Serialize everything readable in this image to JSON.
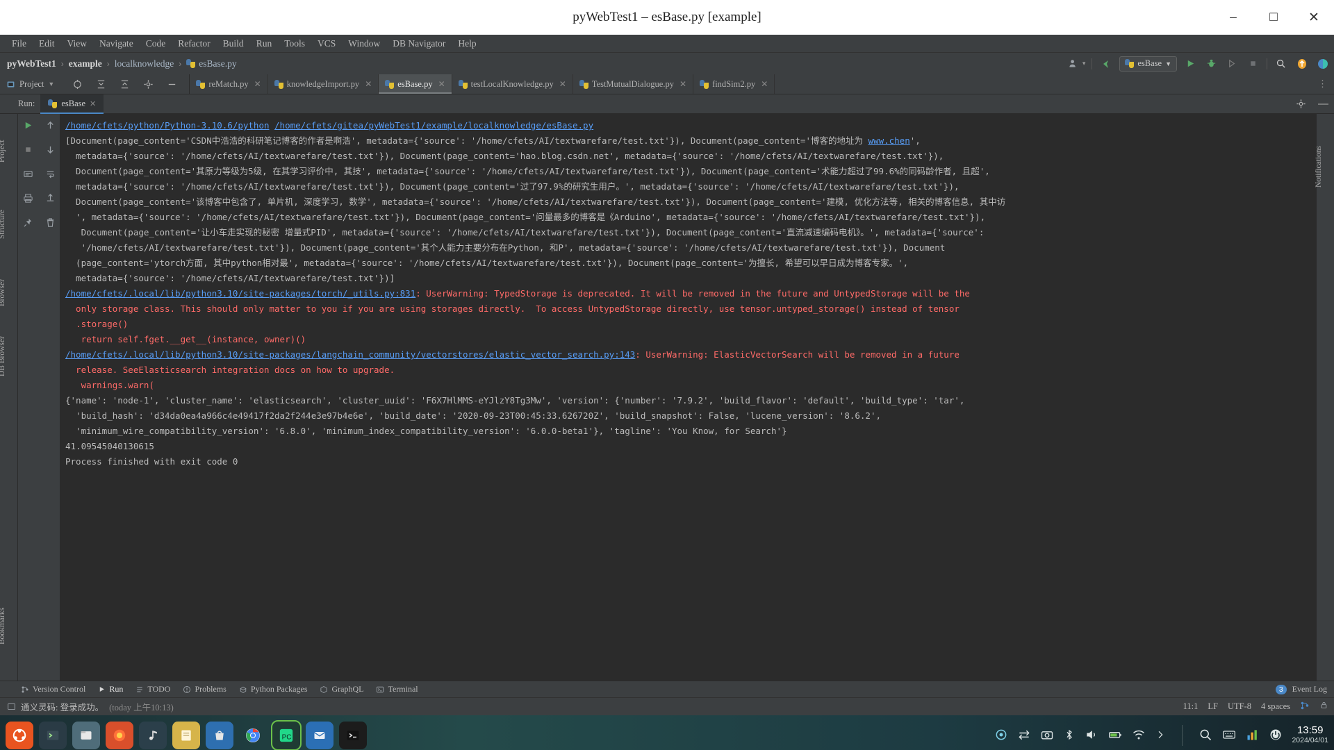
{
  "window": {
    "title": "pyWebTest1 – esBase.py [example]",
    "minimize": "–",
    "maximize": "□",
    "close": "✕"
  },
  "menubar": {
    "items": [
      "File",
      "Edit",
      "View",
      "Navigate",
      "Code",
      "Refactor",
      "Build",
      "Run",
      "Tools",
      "VCS",
      "Window",
      "DB Navigator",
      "Help"
    ]
  },
  "navbar": {
    "crumbs": [
      "pyWebTest1",
      "example",
      "localknowledge",
      "esBase.py"
    ],
    "separator": "›",
    "run_config": "esBase",
    "run_config_caret": "▼",
    "icons": {
      "account": "account-icon",
      "account_caret": "▾",
      "vcs_update": "vcs-update-icon",
      "run": "▶",
      "debug": "debug-icon",
      "coverage": "coverage-icon",
      "stop": "■",
      "search": "search-icon",
      "updates": "updates-icon",
      "tips": "tips-icon"
    }
  },
  "tabbar": {
    "project_button": "Project",
    "project_caret": "▼",
    "toolbar_icons": [
      "target-icon",
      "collapse-all-icon",
      "expand-all-icon",
      "settings-gear-icon",
      "hide-icon"
    ],
    "more_icon": "⋮",
    "files": [
      {
        "name": "reMatch.py",
        "active": false,
        "close": "✕"
      },
      {
        "name": "knowledgeImport.py",
        "active": false,
        "close": "✕"
      },
      {
        "name": "esBase.py",
        "active": true,
        "close": "✕"
      },
      {
        "name": "testLocalKnowledge.py",
        "active": false,
        "close": "✕"
      },
      {
        "name": "TestMutualDialogue.py",
        "active": false,
        "close": "✕"
      },
      {
        "name": "findSim2.py",
        "active": false,
        "close": "✕"
      }
    ]
  },
  "run_window": {
    "label": "Run:",
    "tab": "esBase",
    "tab_close": "✕",
    "settings_icon": "settings-gear-icon",
    "minimize_icon": "—",
    "gutter_icons": [
      "rerun-run-icon",
      "scroll-up-icon",
      "scroll-down-icon",
      "stop-icon",
      "wrap-icon",
      "print-icon",
      "soft-wrap-icon",
      "pin-icon",
      "export-icon",
      "trash-icon"
    ]
  },
  "console": {
    "lines": [
      {
        "type": "cmd",
        "segments": [
          {
            "t": "link",
            "v": "/home/cfets/python/Python-3.10.6/python"
          },
          {
            "t": "plain",
            "v": " "
          },
          {
            "t": "link",
            "v": "/home/cfets/gitea/pyWebTest1/example/localknowledge/esBase.py"
          }
        ]
      },
      {
        "type": "out",
        "segments": [
          {
            "t": "plain",
            "v": "[Document(page_content='CSDN中浩浩的科研笔记博客的作者是啊浩', metadata={'source': '/home/cfets/AI/textwarefare/test.txt'}), Document(page_content='博客的地址为 "
          },
          {
            "t": "link",
            "v": "www.chen"
          },
          {
            "t": "plain",
            "v": "',"
          }
        ]
      },
      {
        "type": "out",
        "segments": [
          {
            "t": "plain",
            "v": "  metadata={'source': '/home/cfets/AI/textwarefare/test.txt'}), Document(page_content='hao.blog.csdn.net', metadata={'source': '/home/cfets/AI/textwarefare/test.txt'}),"
          }
        ]
      },
      {
        "type": "out",
        "segments": [
          {
            "t": "plain",
            "v": "  Document(page_content='其原力等级为5级, 在其学习评价中, 其技', metadata={'source': '/home/cfets/AI/textwarefare/test.txt'}), Document(page_content='术能力超过了99.6%的同码龄作者, 且超',"
          }
        ]
      },
      {
        "type": "out",
        "segments": [
          {
            "t": "plain",
            "v": "  metadata={'source': '/home/cfets/AI/textwarefare/test.txt'}), Document(page_content='过了97.9%的研究生用户。', metadata={'source': '/home/cfets/AI/textwarefare/test.txt'}),"
          }
        ]
      },
      {
        "type": "out",
        "segments": [
          {
            "t": "plain",
            "v": "  Document(page_content='该博客中包含了, 单片机, 深度学习, 数学', metadata={'source': '/home/cfets/AI/textwarefare/test.txt'}), Document(page_content='建模, 优化方法等, 相关的博客信息, 其中访"
          }
        ]
      },
      {
        "type": "out",
        "segments": [
          {
            "t": "plain",
            "v": "  ', metadata={'source': '/home/cfets/AI/textwarefare/test.txt'}), Document(page_content='问量最多的博客是《Arduino', metadata={'source': '/home/cfets/AI/textwarefare/test.txt'}),"
          }
        ]
      },
      {
        "type": "out",
        "segments": [
          {
            "t": "plain",
            "v": "   Document(page_content='让小车走实现的秘密 增量式PID', metadata={'source': '/home/cfets/AI/textwarefare/test.txt'}), Document(page_content='直流减速编码电机》。', metadata={'source':"
          }
        ]
      },
      {
        "type": "out",
        "segments": [
          {
            "t": "plain",
            "v": "   '/home/cfets/AI/textwarefare/test.txt'}), Document(page_content='其个人能力主要分布在Python, 和P', metadata={'source': '/home/cfets/AI/textwarefare/test.txt'}), Document"
          }
        ]
      },
      {
        "type": "out",
        "segments": [
          {
            "t": "plain",
            "v": "  (page_content='ytorch方面, 其中python相对最', metadata={'source': '/home/cfets/AI/textwarefare/test.txt'}), Document(page_content='为擅长, 希望可以早日成为博客专家。',"
          }
        ]
      },
      {
        "type": "out",
        "segments": [
          {
            "t": "plain",
            "v": "  metadata={'source': '/home/cfets/AI/textwarefare/test.txt'})]"
          }
        ]
      },
      {
        "type": "warn",
        "segments": [
          {
            "t": "link",
            "v": "/home/cfets/.local/lib/python3.10/site-packages/torch/_utils.py:831"
          },
          {
            "t": "warn",
            "v": ": UserWarning: TypedStorage is deprecated. It will be removed in the future and UntypedStorage will be the"
          }
        ]
      },
      {
        "type": "warn",
        "segments": [
          {
            "t": "warn",
            "v": "  only storage class. This should only matter to you if you are using storages directly.  To access UntypedStorage directly, use tensor.untyped_storage() instead of tensor"
          }
        ]
      },
      {
        "type": "warn",
        "segments": [
          {
            "t": "warn",
            "v": "  .storage()"
          }
        ]
      },
      {
        "type": "warn",
        "segments": [
          {
            "t": "warn",
            "v": "   return self.fget.__get__(instance, owner)()"
          }
        ]
      },
      {
        "type": "warn",
        "segments": [
          {
            "t": "link",
            "v": "/home/cfets/.local/lib/python3.10/site-packages/langchain_community/vectorstores/elastic_vector_search.py:143"
          },
          {
            "t": "warn",
            "v": ": UserWarning: ElasticVectorSearch will be removed in a future"
          }
        ]
      },
      {
        "type": "warn",
        "segments": [
          {
            "t": "warn",
            "v": "  release. SeeElasticsearch integration docs on how to upgrade."
          }
        ]
      },
      {
        "type": "warn",
        "segments": [
          {
            "t": "warn",
            "v": "   warnings.warn("
          }
        ]
      },
      {
        "type": "out",
        "segments": [
          {
            "t": "plain",
            "v": "{'name': 'node-1', 'cluster_name': 'elasticsearch', 'cluster_uuid': 'F6X7HlMMS-eYJlzY8Tg3Mw', 'version': {'number': '7.9.2', 'build_flavor': 'default', 'build_type': 'tar',"
          }
        ]
      },
      {
        "type": "out",
        "segments": [
          {
            "t": "plain",
            "v": "  'build_hash': 'd34da0ea4a966c4e49417f2da2f244e3e97b4e6e', 'build_date': '2020-09-23T00:45:33.626720Z', 'build_snapshot': False, 'lucene_version': '8.6.2',"
          }
        ]
      },
      {
        "type": "out",
        "segments": [
          {
            "t": "plain",
            "v": "  'minimum_wire_compatibility_version': '6.8.0', 'minimum_index_compatibility_version': '6.0.0-beta1'}, 'tagline': 'You Know, for Search'}"
          }
        ]
      },
      {
        "type": "out",
        "segments": [
          {
            "t": "plain",
            "v": "41.09545040130615"
          }
        ]
      },
      {
        "type": "out",
        "segments": [
          {
            "t": "plain",
            "v": ""
          }
        ]
      },
      {
        "type": "out",
        "segments": [
          {
            "t": "plain",
            "v": "Process finished with exit code 0"
          }
        ]
      }
    ]
  },
  "left_strips": [
    "Project",
    "Structure",
    "Browser",
    "DB Browser",
    "Bookmarks"
  ],
  "right_strips": [
    "Notifications"
  ],
  "toolstrip": {
    "items": [
      {
        "label": "Version Control",
        "icon": "branch-icon"
      },
      {
        "label": "Run",
        "icon": "run-icon"
      },
      {
        "label": "TODO",
        "icon": "todo-icon"
      },
      {
        "label": "Problems",
        "icon": "problems-icon"
      },
      {
        "label": "Python Packages",
        "icon": "packages-icon"
      },
      {
        "label": "GraphQL",
        "icon": "graphql-icon"
      },
      {
        "label": "Terminal",
        "icon": "terminal-icon"
      }
    ],
    "event_log": "Event Log",
    "event_count": "3"
  },
  "statusbar": {
    "message": "通义灵码: 登录成功。",
    "time_hint": "(today 上午10:13)",
    "caret": "11:1",
    "line_ending": "LF",
    "encoding": "UTF-8",
    "indent": "4 spaces",
    "lock_icon": "lock-icon",
    "branch_icon": "branch-icon"
  },
  "taskbar": {
    "apps": [
      "ubuntu-icon",
      "terminal-icon",
      "files-icon",
      "firefox-icon",
      "music-icon",
      "notes-icon",
      "store-icon",
      "chrome-icon",
      "pycharm-icon",
      "mail-icon",
      "console-icon"
    ],
    "tray": [
      "ai-icon",
      "swap-icon",
      "screenshot-icon",
      "bluetooth-icon",
      "volume-icon",
      "battery-icon",
      "network-icon",
      "chevron-icon"
    ],
    "clock_time": "13:59",
    "clock_date": "2024/04/01",
    "search_icon": "search-icon",
    "keyboard_icon": "keyboard-icon",
    "chart_icon": "chart-icon",
    "power_icon": "power-icon"
  },
  "colors": {
    "accent": "#4a88c7",
    "warn": "#ff6b68",
    "link": "#589df6",
    "bg": "#3c3f41",
    "console_bg": "#2b2b2b"
  }
}
